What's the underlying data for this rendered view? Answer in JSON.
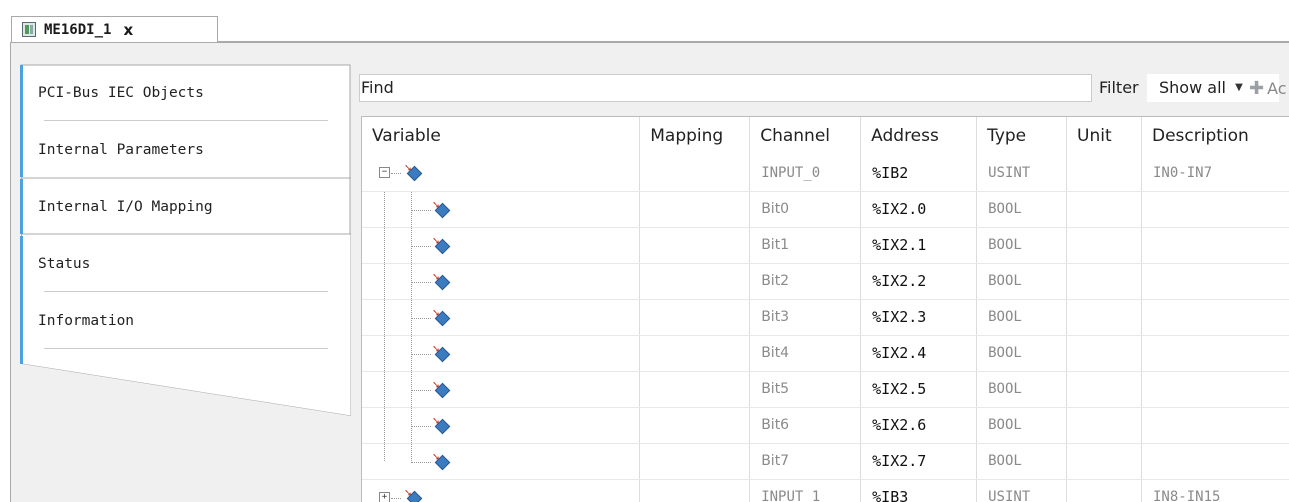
{
  "doc_tab": {
    "title": "ME16DI_1",
    "close_glyph": "x",
    "icon": "device-module-icon"
  },
  "side_tabs": [
    {
      "label": "PCI-Bus IEC Objects",
      "active": false
    },
    {
      "label": "Internal Parameters",
      "active": false
    },
    {
      "label": "Internal I/O Mapping",
      "active": true
    },
    {
      "label": "Status",
      "active": false
    },
    {
      "label": "Information",
      "active": false
    }
  ],
  "filterbar": {
    "find_label": "Find",
    "filter_label": "Filter",
    "filter_value": "Show all",
    "add_label": "Ac",
    "add_icon": "plus-icon"
  },
  "table": {
    "columns": [
      "Variable",
      "Mapping",
      "Channel",
      "Address",
      "Type",
      "Unit",
      "Description"
    ],
    "rows": [
      {
        "level": 0,
        "expander": "−",
        "channel": "INPUT_0",
        "address": "%IB2",
        "type": "USINT",
        "unit": "",
        "description": "IN0-IN7"
      },
      {
        "level": 1,
        "expander": "",
        "channel": "Bit0",
        "address": "%IX2.0",
        "type": "BOOL",
        "unit": "",
        "description": ""
      },
      {
        "level": 1,
        "expander": "",
        "channel": "Bit1",
        "address": "%IX2.1",
        "type": "BOOL",
        "unit": "",
        "description": ""
      },
      {
        "level": 1,
        "expander": "",
        "channel": "Bit2",
        "address": "%IX2.2",
        "type": "BOOL",
        "unit": "",
        "description": ""
      },
      {
        "level": 1,
        "expander": "",
        "channel": "Bit3",
        "address": "%IX2.3",
        "type": "BOOL",
        "unit": "",
        "description": ""
      },
      {
        "level": 1,
        "expander": "",
        "channel": "Bit4",
        "address": "%IX2.4",
        "type": "BOOL",
        "unit": "",
        "description": ""
      },
      {
        "level": 1,
        "expander": "",
        "channel": "Bit5",
        "address": "%IX2.5",
        "type": "BOOL",
        "unit": "",
        "description": ""
      },
      {
        "level": 1,
        "expander": "",
        "channel": "Bit6",
        "address": "%IX2.6",
        "type": "BOOL",
        "unit": "",
        "description": ""
      },
      {
        "level": 1,
        "expander": "",
        "channel": "Bit7",
        "address": "%IX2.7",
        "type": "BOOL",
        "unit": "",
        "description": ""
      },
      {
        "level": 0,
        "expander": "+",
        "channel": "INPUT_1",
        "address": "%IB3",
        "type": "USINT",
        "unit": "",
        "description": "IN8-IN15"
      }
    ]
  },
  "colors": {
    "accent_blue": "#4aa3df",
    "frame_gray": "#a9a9a9",
    "muted_text": "#8a8a8a"
  }
}
